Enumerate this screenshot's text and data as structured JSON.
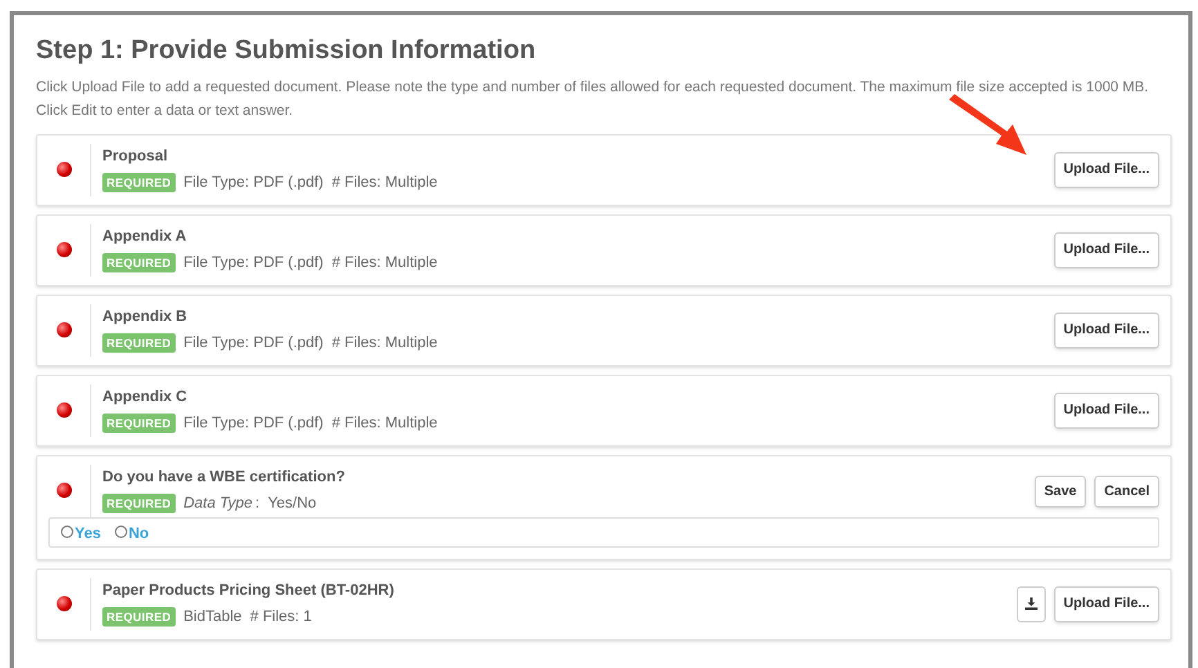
{
  "heading": "Step 1: Provide Submission Information",
  "instructions": [
    "Click Upload File to add a requested document. Please note the type and number of files allowed for each requested document. The maximum file size accepted is 1000 MB.",
    "Click Edit to enter a data or text answer."
  ],
  "items": [
    {
      "kind": "file",
      "title": "Proposal",
      "badge": "REQUIRED",
      "details": [
        "File Type: PDF (.pdf)",
        "# Files: Multiple"
      ],
      "buttons": [
        "Upload File..."
      ],
      "highlighted": true
    },
    {
      "kind": "file",
      "title": "Appendix A",
      "badge": "REQUIRED",
      "details": [
        "File Type: PDF (.pdf)",
        "# Files: Multiple"
      ],
      "buttons": [
        "Upload File..."
      ],
      "highlighted": false
    },
    {
      "kind": "file",
      "title": "Appendix B",
      "badge": "REQUIRED",
      "details": [
        "File Type: PDF (.pdf)",
        "# Files: Multiple"
      ],
      "buttons": [
        "Upload File..."
      ],
      "highlighted": false
    },
    {
      "kind": "file",
      "title": "Appendix C",
      "badge": "REQUIRED",
      "details": [
        "File Type: PDF (.pdf)",
        "# Files: Multiple"
      ],
      "buttons": [
        "Upload File..."
      ],
      "highlighted": false
    },
    {
      "kind": "question",
      "title": "Do you have a WBE certification?",
      "badge": "REQUIRED",
      "data_label": "Data Type",
      "data_separator": ":",
      "data_value": "Yes/No",
      "buttons": [
        "Save",
        "Cancel"
      ],
      "options": [
        {
          "label": "Yes",
          "selected": false
        },
        {
          "label": "No",
          "selected": false
        }
      ],
      "highlighted": false
    },
    {
      "kind": "bidtable",
      "title": "Paper Products Pricing Sheet (BT-02HR)",
      "badge": "REQUIRED",
      "details": [
        "BidTable",
        "# Files: 1"
      ],
      "buttons": [
        "Upload File..."
      ],
      "highlighted": false
    }
  ]
}
